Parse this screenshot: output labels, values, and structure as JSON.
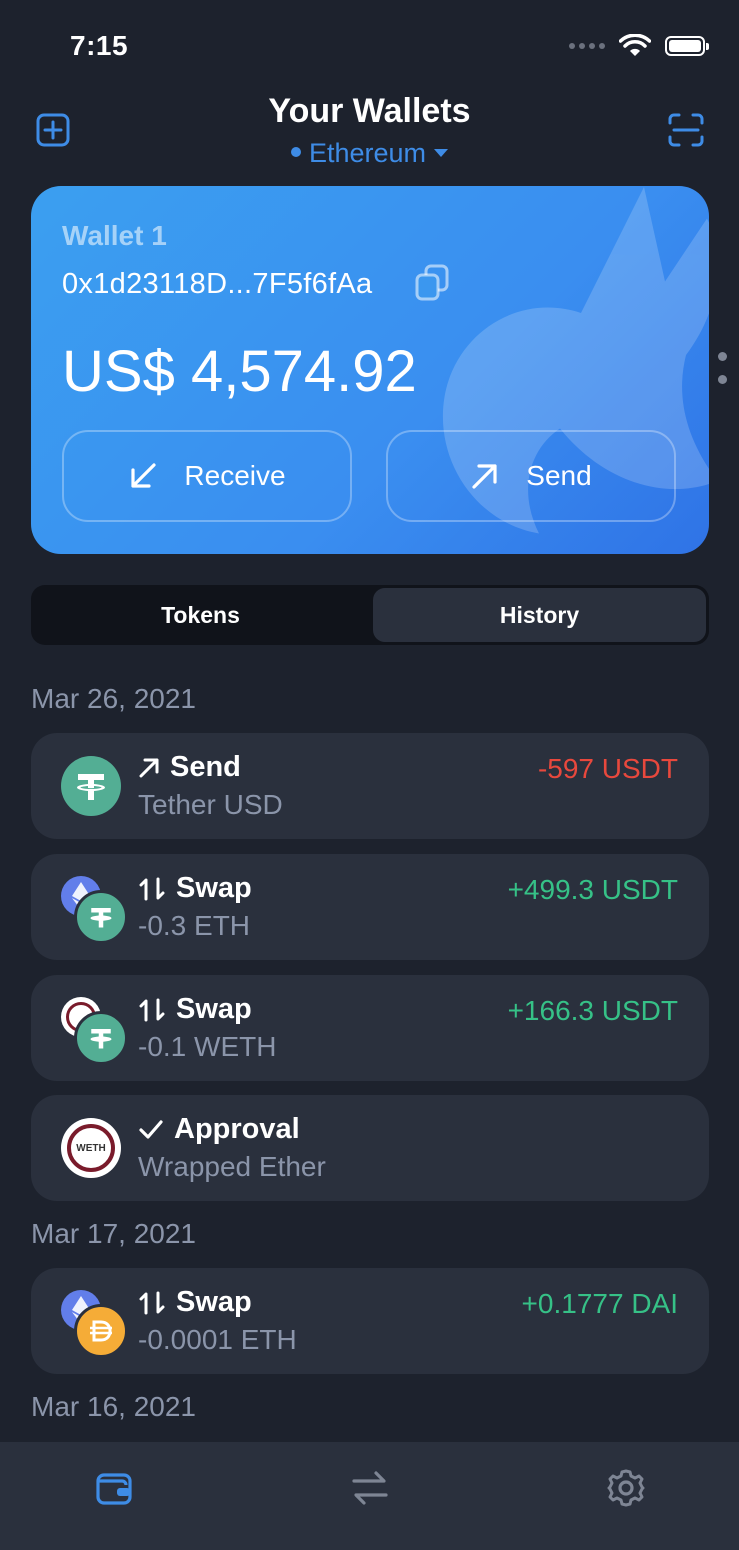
{
  "status": {
    "time": "7:15"
  },
  "header": {
    "title": "Your Wallets",
    "network": "Ethereum"
  },
  "wallet": {
    "name": "Wallet 1",
    "address": "0x1d23118D...7F5f6fAa",
    "balance": "US$ 4,574.92",
    "receive_label": "Receive",
    "send_label": "Send"
  },
  "tabs": {
    "tokens": "Tokens",
    "history": "History",
    "active": "History"
  },
  "history": {
    "groups": [
      {
        "date": "Mar 26, 2021",
        "items": [
          {
            "type": "Send",
            "subtitle": "Tether USD",
            "amount": "-597 USDT",
            "amount_color": "#e8483d"
          },
          {
            "type": "Swap",
            "subtitle": "-0.3 ETH",
            "amount": "+499.3 USDT",
            "amount_color": "#36c187"
          },
          {
            "type": "Swap",
            "subtitle": "-0.1 WETH",
            "amount": "+166.3 USDT",
            "amount_color": "#36c187"
          },
          {
            "type": "Approval",
            "subtitle": "Wrapped Ether",
            "amount": ""
          }
        ]
      },
      {
        "date": "Mar 17, 2021",
        "items": [
          {
            "type": "Swap",
            "subtitle": "-0.0001 ETH",
            "amount": "+0.1777 DAI",
            "amount_color": "#36c187"
          }
        ]
      },
      {
        "date": "Mar 16, 2021",
        "items": []
      }
    ]
  },
  "colors": {
    "accent": "#3e8ce6",
    "background": "#1d222d",
    "card_bg": "#2a303d",
    "negative": "#e8483d",
    "positive": "#36c187"
  },
  "icons": {
    "add": "add-wallet-icon",
    "scan": "scan-icon",
    "copy": "copy-icon",
    "receive": "arrow-down-left-icon",
    "send": "arrow-up-right-icon",
    "nav": [
      "wallet-icon",
      "swap-arrows-icon",
      "gear-icon"
    ]
  },
  "labels": {
    "weth_logo": "WETH"
  }
}
